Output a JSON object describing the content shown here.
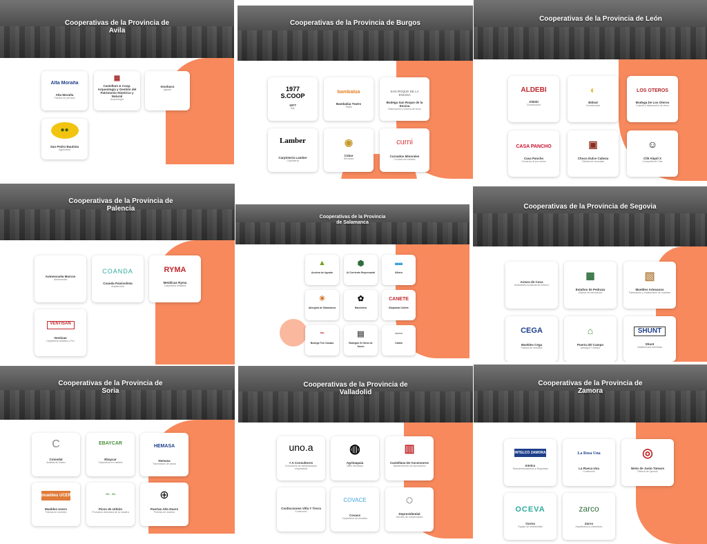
{
  "colors": {
    "accent": "#f7895d",
    "banner": "#5e5e5e"
  },
  "panels": {
    "avila": {
      "title": "Cooperativas de la Provincia de Avila",
      "cards": [
        {
          "logo": "Alta Moraña",
          "name": "Alta Moraña",
          "desc": "Fabrica de piensos"
        },
        {
          "logo": "▦",
          "name": "Castellum & Coop. Arqueología y Gestión del Patrimonio Histórico y Natural",
          "desc": "Arqueología"
        },
        {
          "logo": "",
          "name": "Innobaco",
          "desc": "Agraria"
        },
        {
          "logo": "●●",
          "name": "San Pedro Bautista",
          "desc": "Agricultura"
        }
      ]
    },
    "burgos": {
      "title": "Cooperativas de la Provincia de Burgos",
      "cards": [
        {
          "logo": "1977 S.COOP",
          "name": "1977",
          "desc": "Bar"
        },
        {
          "logo": "bambalúa",
          "name": "Bambalúa Teatro",
          "desc": "Teatro"
        },
        {
          "logo": "SAN ROQUE DE LA ENCINA",
          "name": "Bodega San Roque de la Encina",
          "desc": "Elaboración y crianza de vinos"
        },
        {
          "logo": "Lamber",
          "name": "Carpintería Lamber",
          "desc": "Carpintería"
        },
        {
          "logo": "◉",
          "name": "Cobar",
          "desc": "Servicios"
        },
        {
          "logo": "curni",
          "name": "Curvados Minerales",
          "desc": "Curvado de metales"
        }
      ]
    },
    "leon": {
      "title": "Cooperativas de la Provincia de León",
      "cards": [
        {
          "logo": "ALDEBI",
          "name": "Aldebi",
          "desc": "Construcción"
        },
        {
          "logo": "◐",
          "name": "Bidval",
          "desc": "Construcción"
        },
        {
          "logo": "LOS OTEROS",
          "name": "Bodega De Los Oteros",
          "desc": "Crianza y elaboración de vinos"
        },
        {
          "logo": "CASA PANCHO",
          "name": "Casa Pancho",
          "desc": "Comercio al por menor"
        },
        {
          "logo": "▣",
          "name": "Choco Dulce Cabeza",
          "desc": "Fábrica de chocolate"
        },
        {
          "logo": "☺",
          "name": "Clik Alquil X",
          "desc": "Compañía de Cine"
        }
      ]
    },
    "palencia": {
      "title": "Cooperativas de la Provincia de Palencia",
      "cards": [
        {
          "logo": "",
          "name": "Autoescuela Marcos",
          "desc": "Autoescuela"
        },
        {
          "logo": "COANDA",
          "name": "Coanda Paisivolista",
          "desc": "Arquitectura"
        },
        {
          "logo": "RYMA",
          "name": "Metálicas Ryma",
          "desc": "Carpintería metálica"
        },
        {
          "logo": "VENTISAN",
          "name": "Ventisan",
          "desc": "Carpintería metálica y Pvc"
        }
      ]
    },
    "salamanca": {
      "title": "Cooperativas de la Provincia de Salamanca",
      "cards": [
        {
          "logo": "▲",
          "name": "Acutera de Agrado",
          "desc": ""
        },
        {
          "logo": "⬢",
          "name": "Al Corriente Empresarial",
          "desc": ""
        },
        {
          "logo": "▬",
          "name": "Albero",
          "desc": ""
        },
        {
          "logo": "☀",
          "name": "Ailorgina de Salamanca",
          "desc": ""
        },
        {
          "logo": "✿",
          "name": "Bandolera",
          "desc": ""
        },
        {
          "logo": "CAÑETE",
          "name": "Bioplanta Cañete",
          "desc": ""
        },
        {
          "logo": "~",
          "name": "Bodega Tiro Casaas",
          "desc": ""
        },
        {
          "logo": "▤",
          "name": "Bodegas Si Otras de Duero",
          "desc": ""
        },
        {
          "logo": "—",
          "name": "Catam",
          "desc": ""
        }
      ]
    },
    "segovia": {
      "title": "Cooperativas de la Provincia de Segovia",
      "cards": [
        {
          "logo": "",
          "name": "Actura de Coca",
          "desc": "Actividades turísticas de entorno"
        },
        {
          "logo": "▦",
          "name": "Estaños de Pedraza",
          "desc": "Objetos de decoración"
        },
        {
          "logo": "▧",
          "name": "Muebles Artesanos",
          "desc": "Fabricación y restauración de muebles"
        },
        {
          "logo": "CEGA",
          "name": "Muebles Cega",
          "desc": "Fábrica de muebles"
        },
        {
          "logo": "⌂",
          "name": "Puerta del Campo",
          "desc": "Albergue Turístico"
        },
        {
          "logo": "SHUNT",
          "name": "Shunt",
          "desc": "Instalaciones eléctricas"
        }
      ]
    },
    "soria": {
      "title": "Cooperativas de la Provincia de Soria",
      "cards": [
        {
          "logo": "C",
          "name": "Coinsdal",
          "desc": "Análisis de mateo"
        },
        {
          "logo": "EBAYCAR",
          "name": "Ebaycar",
          "desc": "Carpintería en madera"
        },
        {
          "logo": "HEMASA",
          "name": "Hemasa",
          "desc": "Transmisión de pesos"
        },
        {
          "logo": "muebles UCERO",
          "name": "Muebles Ucero",
          "desc": "Fabrica de muebles"
        },
        {
          "logo": "~ ~",
          "name": "Picos de Urbión",
          "desc": "Productos derivados de la madera"
        },
        {
          "logo": "⊕",
          "name": "Puertas Alto Duero",
          "desc": "Puertas de madera"
        }
      ]
    },
    "valladolid": {
      "title": "Cooperativas de la Provincia de Valladolid",
      "cards": [
        {
          "logo": "uno.a",
          "name": "7.A Consultores",
          "desc": "Consultoría de administración empresarial"
        },
        {
          "logo": "◍",
          "name": "Agrimapaia",
          "desc": "Taller Mecánico"
        },
        {
          "logo": "▥",
          "name": "Castellana De Ascensores",
          "desc": "Mantenimiento de ascensores"
        },
        {
          "logo": "",
          "name": "Confecciones Villa Y Tierra",
          "desc": "Confección"
        },
        {
          "logo": "COVACE",
          "name": "Covace",
          "desc": "Carpintería de aluminio"
        },
        {
          "logo": "◌",
          "name": "Depresidential",
          "desc": "Servicio de conservación"
        }
      ]
    },
    "zamora": {
      "title": "Cooperativas de la Provincia de Zamora",
      "cards": [
        {
          "logo": "INTELCO ZAMORA",
          "name": "Intelco",
          "desc": "Telecomunicaciones y Seguridad"
        },
        {
          "logo": "La Rosa Una",
          "name": "La Rueca Una",
          "desc": "Confección"
        },
        {
          "logo": "◎",
          "name": "Nieto de Justo Tamaro",
          "desc": "Fábrica de Quesos"
        },
        {
          "logo": "OCEVA",
          "name": "Oceva",
          "desc": "Equipo de selectividad"
        },
        {
          "logo": "zarco",
          "name": "Zarco",
          "desc": "Arquitectura y urbanismo"
        }
      ]
    }
  }
}
